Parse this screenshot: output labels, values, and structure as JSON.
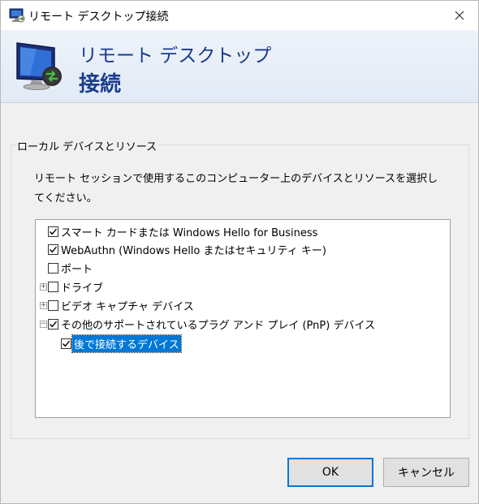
{
  "window": {
    "title": "リモート デスクトップ接続",
    "icon": "remote-desktop-icon",
    "close_icon": "close-icon"
  },
  "banner": {
    "line1": "リモート デスクトップ",
    "line2": "接続",
    "icon": "remote-desktop-monitor-icon"
  },
  "group": {
    "legend": "ローカル デバイスとリソース",
    "description": "リモート セッションで使用するこのコンピューター上のデバイスとリソースを選択してください。"
  },
  "tree": {
    "items": [
      {
        "label": "スマート カードまたは Windows Hello for Business",
        "checked": true,
        "expander": ""
      },
      {
        "label": "WebAuthn (Windows Hello またはセキュリティ キー)",
        "checked": true,
        "expander": ""
      },
      {
        "label": "ポート",
        "checked": false,
        "expander": ""
      },
      {
        "label": "ドライブ",
        "checked": false,
        "expander": "+"
      },
      {
        "label": "ビデオ キャプチャ デバイス",
        "checked": false,
        "expander": "+"
      },
      {
        "label": "その他のサポートされているプラグ アンド プレイ (PnP) デバイス",
        "checked": true,
        "expander": "−"
      },
      {
        "label": "後で接続するデバイス",
        "checked": true,
        "expander": "",
        "selected": true
      }
    ]
  },
  "buttons": {
    "ok": "OK",
    "cancel": "キャンセル"
  },
  "colors": {
    "accent": "#0078d7",
    "banner_text": "#1a3c8c"
  }
}
